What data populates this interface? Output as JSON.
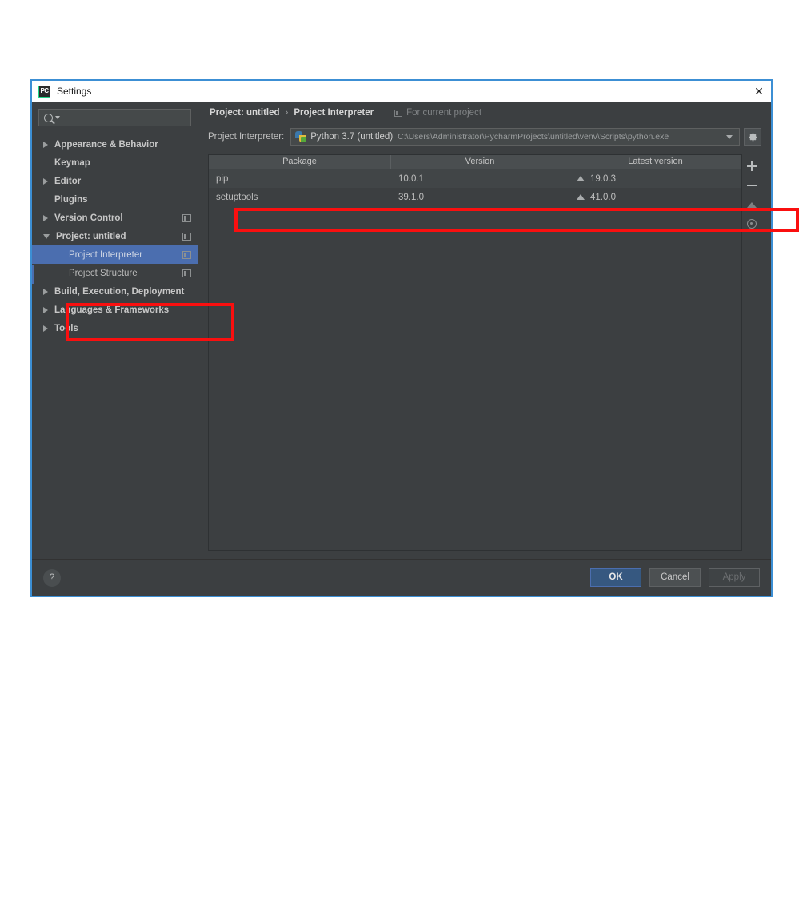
{
  "window": {
    "title": "Settings",
    "app_icon": "PC",
    "close_icon": "close-icon"
  },
  "sidebar": {
    "search": {
      "placeholder": "",
      "value": "",
      "icon": "search-icon"
    },
    "items": [
      {
        "label": "Appearance & Behavior",
        "arrow": "collapsed",
        "level": 1,
        "bold": true,
        "badge": false,
        "selected": false
      },
      {
        "label": "Keymap",
        "arrow": "none",
        "level": 1,
        "bold": true,
        "badge": false,
        "selected": false
      },
      {
        "label": "Editor",
        "arrow": "collapsed",
        "level": 1,
        "bold": true,
        "badge": false,
        "selected": false
      },
      {
        "label": "Plugins",
        "arrow": "none",
        "level": 1,
        "bold": true,
        "badge": false,
        "selected": false
      },
      {
        "label": "Version Control",
        "arrow": "collapsed",
        "level": 1,
        "bold": true,
        "badge": true,
        "selected": false
      },
      {
        "label": "Project: untitled",
        "arrow": "expanded",
        "level": 1,
        "bold": true,
        "badge": true,
        "selected": false
      },
      {
        "label": "Project Interpreter",
        "arrow": "none",
        "level": 2,
        "bold": false,
        "badge": true,
        "selected": true
      },
      {
        "label": "Project Structure",
        "arrow": "none",
        "level": 2,
        "bold": false,
        "badge": true,
        "selected": false
      },
      {
        "label": "Build, Execution, Deployment",
        "arrow": "collapsed",
        "level": 1,
        "bold": true,
        "badge": false,
        "selected": false
      },
      {
        "label": "Languages & Frameworks",
        "arrow": "collapsed",
        "level": 1,
        "bold": true,
        "badge": false,
        "selected": false
      },
      {
        "label": "Tools",
        "arrow": "collapsed",
        "level": 1,
        "bold": true,
        "badge": false,
        "selected": false
      }
    ]
  },
  "main": {
    "breadcrumb": {
      "parent": "Project: untitled",
      "separator": "›",
      "current": "Project Interpreter",
      "scope": "For current project",
      "scope_icon": "project-scope-icon"
    },
    "interpreter": {
      "label": "Project Interpreter:",
      "icon": "python-icon",
      "name": "Python 3.7 (untitled)",
      "path": "C:\\Users\\Administrator\\PycharmProjects\\untitled\\venv\\Scripts\\python.exe",
      "dropdown_icon": "chevron-down-icon",
      "gear_icon": "gear-icon"
    },
    "packages_table": {
      "columns": [
        "Package",
        "Version",
        "Latest version"
      ],
      "rows": [
        {
          "package": "pip",
          "version": "10.0.1",
          "latest": "19.0.3",
          "upgradable": true
        },
        {
          "package": "setuptools",
          "version": "39.1.0",
          "latest": "41.0.0",
          "upgradable": true
        }
      ]
    },
    "table_tools": [
      {
        "name": "install-package-button",
        "icon": "plus-icon"
      },
      {
        "name": "uninstall-package-button",
        "icon": "minus-icon"
      },
      {
        "name": "upgrade-package-button",
        "icon": "up-triangle-icon"
      },
      {
        "name": "show-early-releases-button",
        "icon": "eye-icon"
      }
    ]
  },
  "footer": {
    "help_label": "?",
    "ok_label": "OK",
    "cancel_label": "Cancel",
    "apply_label": "Apply"
  },
  "colors": {
    "background": "#3c3f41",
    "selection": "#4b6eaf",
    "primary_button": "#365880",
    "annotation": "#fa0f0f",
    "window_border": "#3c8fd4"
  }
}
